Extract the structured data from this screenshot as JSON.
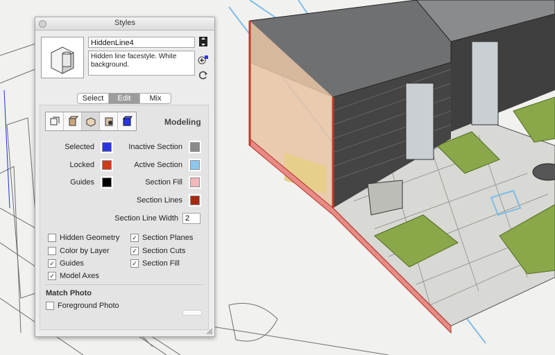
{
  "panel": {
    "title": "Styles",
    "style_name": "HiddenLine4",
    "style_description": "Hidden line facestyle. White background.",
    "tabs": [
      {
        "label": "Select",
        "active": false
      },
      {
        "label": "Edit",
        "active": true
      },
      {
        "label": "Mix",
        "active": false
      }
    ],
    "section_title": "Modeling",
    "edit_icons": [
      "edge-settings-icon",
      "face-settings-icon",
      "background-settings-icon",
      "watermark-settings-icon",
      "modeling-settings-icon"
    ],
    "colors": {
      "selected": {
        "label": "Selected",
        "color": "#2a35e8"
      },
      "locked": {
        "label": "Locked",
        "color": "#d23a1a"
      },
      "guides": {
        "label": "Guides",
        "color": "#000000"
      },
      "inactive_section": {
        "label": "Inactive Section",
        "color": "#8a8a8a"
      },
      "active_section": {
        "label": "Active Section",
        "color": "#8cc8ee"
      },
      "section_fill": {
        "label": "Section Fill",
        "color": "#f2b8bc"
      },
      "section_lines": {
        "label": "Section Lines",
        "color": "#a52a10"
      }
    },
    "section_line_width": {
      "label": "Section Line Width",
      "value": "2"
    },
    "checkboxes": {
      "hidden_geometry": {
        "label": "Hidden Geometry",
        "checked": false
      },
      "color_by_layer": {
        "label": "Color by Layer",
        "checked": false
      },
      "guides": {
        "label": "Guides",
        "checked": true
      },
      "model_axes": {
        "label": "Model Axes",
        "checked": true
      },
      "section_planes": {
        "label": "Section Planes",
        "checked": true
      },
      "section_cuts": {
        "label": "Section Cuts",
        "checked": true
      },
      "section_fill": {
        "label": "Section Fill",
        "checked": true
      }
    },
    "match_photo": {
      "title": "Match Photo",
      "foreground_photo": {
        "label": "Foreground Photo",
        "checked": false
      }
    }
  }
}
